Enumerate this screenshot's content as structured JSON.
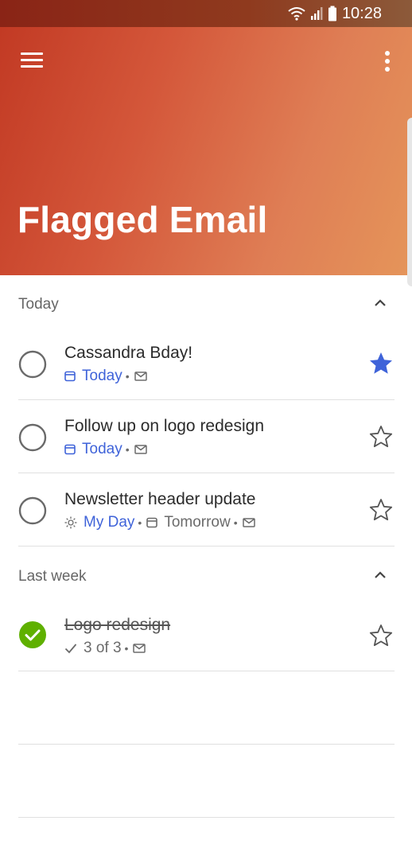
{
  "status_bar": {
    "time": "10:28",
    "icons": [
      "wifi-icon",
      "signal-icon",
      "battery-icon"
    ]
  },
  "header": {
    "title": "Flagged Email",
    "menu_icon": "hamburger-icon",
    "more_icon": "more-vertical-icon"
  },
  "colors": {
    "accent_blue": "#3f63d9",
    "complete_green": "#5fb000",
    "header_start": "#c23a24",
    "header_end": "#e5955a"
  },
  "sections": [
    {
      "label": "Today",
      "expanded": true,
      "tasks": [
        {
          "title": "Cassandra Bday!",
          "due": "Today",
          "due_icon": "calendar-icon",
          "flag_icon": "mail-icon",
          "starred": true,
          "completed": false
        },
        {
          "title": "Follow up on logo redesign",
          "due": "Today",
          "due_icon": "calendar-icon",
          "flag_icon": "mail-icon",
          "starred": false,
          "completed": false
        },
        {
          "title": "Newsletter header update",
          "my_day": "My Day",
          "my_day_icon": "sun-icon",
          "due": "Tomorrow",
          "due_icon": "calendar-icon",
          "flag_icon": "mail-icon",
          "starred": false,
          "completed": false
        }
      ]
    },
    {
      "label": "Last week",
      "expanded": true,
      "tasks": [
        {
          "title": "Logo redesign",
          "steps": "3 of 3",
          "steps_icon": "check-icon",
          "flag_icon": "mail-icon",
          "starred": false,
          "completed": true
        }
      ]
    }
  ]
}
